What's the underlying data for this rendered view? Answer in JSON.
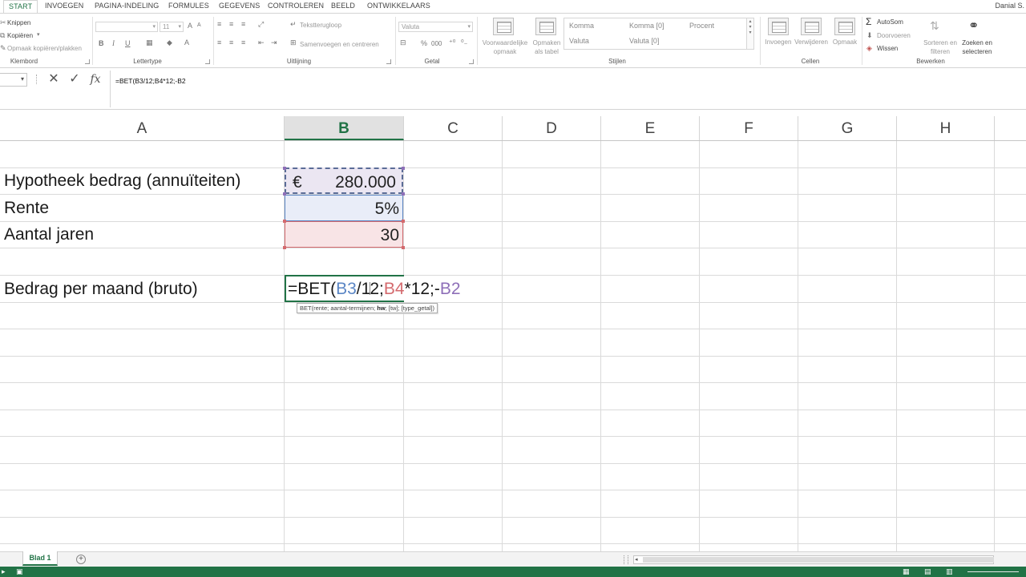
{
  "tabs": [
    "START",
    "INVOEGEN",
    "PAGINA-INDELING",
    "FORMULES",
    "GEGEVENS",
    "CONTROLEREN",
    "BEELD",
    "ONTWIKKELAARS"
  ],
  "active_tab": "START",
  "user_name": "Danial S.",
  "ribbon": {
    "clipboard": {
      "cut": "Knippen",
      "copy": "Kopiëren",
      "format_painter": "Opmaak kopiëren/plakken",
      "label": "Klembord"
    },
    "font": {
      "font_size": "11",
      "label": "Lettertype",
      "bold": "B",
      "italic": "I",
      "underline": "U"
    },
    "alignment": {
      "wrap_text": "Tekstterugloop",
      "merge": "Samenvoegen en centreren",
      "label": "Uitlijning"
    },
    "number": {
      "format": "Valuta",
      "percent": "%",
      "comma": "000",
      "label": "Getal"
    },
    "styles": {
      "conditional": "Voorwaardelijke opmaak",
      "as_table": "Opmaken als tabel",
      "gallery": [
        "Komma",
        "Komma [0]",
        "Procent",
        "Valuta",
        "Valuta [0]"
      ],
      "label": "Stijlen"
    },
    "cells": {
      "insert": "Invoegen",
      "delete": "Verwijderen",
      "format": "Opmaak",
      "label": "Cellen"
    },
    "editing": {
      "autosum": "AutoSom",
      "fill": "Doorvoeren",
      "clear": "Wissen",
      "sort": "Sorteren en filteren",
      "find": "Zoeken en selecteren",
      "label": "Bewerken"
    }
  },
  "formula_bar": {
    "name_box": "",
    "cancel_icon": "close-icon",
    "enter_icon": "check-icon",
    "fx": "fx",
    "formula": "=BET(B3/12;B4*12;-B2"
  },
  "columns": [
    "A",
    "B",
    "C",
    "D",
    "E",
    "F",
    "G",
    "H"
  ],
  "selected_column": "B",
  "cells": {
    "A3": "Hypotheek bedrag (annuïteiten)",
    "A4": "Rente",
    "A5": "Aantal jaren",
    "A7": "Bedrag per maand (bruto)",
    "B3_currency": "€",
    "B3": "280.000",
    "B4": "5%",
    "B5": "30"
  },
  "edit_cell": {
    "prefix": "=BET(",
    "ref1": "B3",
    "mid1": "/1",
    "mid1b": "2;",
    "ref2": "B4",
    "mid2": "*12;-",
    "ref3": "B2"
  },
  "tooltip": {
    "prefix": "BET(rente; aantal-termijnen; ",
    "current_arg": "hw",
    "suffix": "; [tw]; [type_getal])"
  },
  "sheet_tab": "Blad 1",
  "colors": {
    "excel_green": "#217346",
    "ref_blue": "#5b86c5",
    "ref_red": "#d46a6e",
    "ref_purple": "#8e6fb8"
  }
}
